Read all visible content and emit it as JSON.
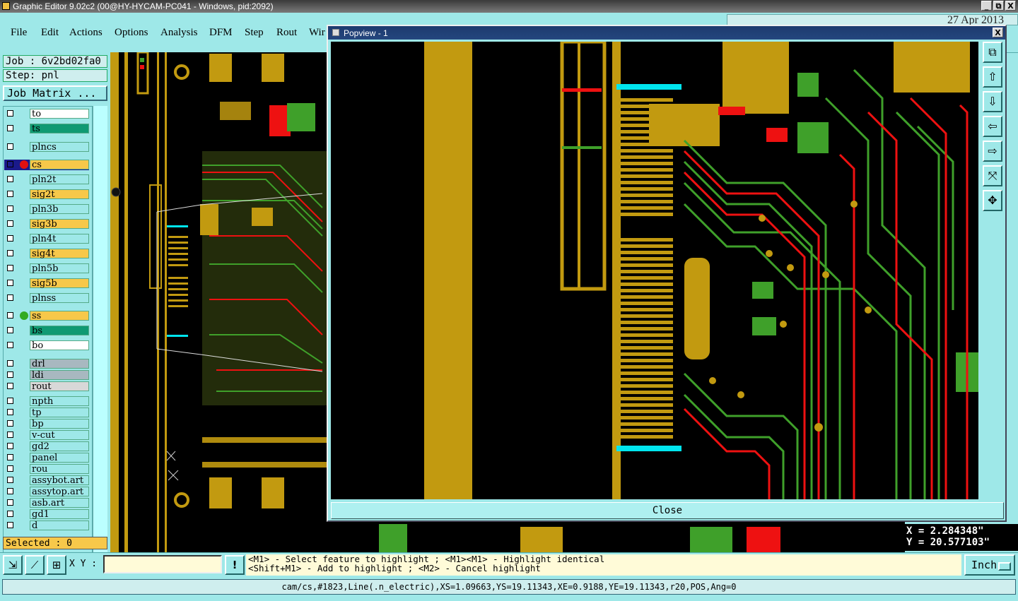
{
  "window": {
    "title": "Graphic Editor 9.02c2 (00@HY-HYCAM-PC041 - Windows, pid:2092)",
    "buttons": [
      "_",
      "⧉",
      "X"
    ]
  },
  "menu": {
    "items": [
      "File",
      "Edit",
      "Actions",
      "Options",
      "Analysis",
      "DFM",
      "Step",
      "Rout",
      "Wir"
    ],
    "date_text": "27 Apr 2013"
  },
  "left_panel": {
    "job": "Job : 6v2bd02fa0",
    "step": "Step: pnl",
    "job_matrix_label": "Job Matrix ...",
    "selected": "Selected : 0",
    "layers": [
      {
        "name": "to",
        "color": "#ffffff",
        "dot": ""
      },
      {
        "name": "ts",
        "color": "#0f9a73",
        "dot": ""
      },
      {
        "name": "plncs",
        "color": "#9ee8e8",
        "dot": ""
      },
      {
        "name": "cs",
        "color": "#f7c84a",
        "dot": "#e01010",
        "active": true
      },
      {
        "name": "pln2t",
        "color": "#9ee8e8",
        "dot": ""
      },
      {
        "name": "sig2t",
        "color": "#f7c84a",
        "dot": ""
      },
      {
        "name": "pln3b",
        "color": "#9ee8e8",
        "dot": ""
      },
      {
        "name": "sig3b",
        "color": "#f7c84a",
        "dot": ""
      },
      {
        "name": "pln4t",
        "color": "#9ee8e8",
        "dot": ""
      },
      {
        "name": "sig4t",
        "color": "#f7c84a",
        "dot": ""
      },
      {
        "name": "pln5b",
        "color": "#9ee8e8",
        "dot": ""
      },
      {
        "name": "sig5b",
        "color": "#f7c84a",
        "dot": ""
      },
      {
        "name": "plnss",
        "color": "#9ee8e8",
        "dot": ""
      },
      {
        "name": "ss",
        "color": "#f7c84a",
        "dot": "#33aa22"
      },
      {
        "name": "bs",
        "color": "#0f9a73",
        "dot": ""
      },
      {
        "name": "bo",
        "color": "#ffffff",
        "dot": ""
      },
      {
        "name": "drl",
        "color": "#a8b8c0",
        "dot": ""
      },
      {
        "name": "ldi",
        "color": "#a8b8c0",
        "dot": ""
      },
      {
        "name": "rout",
        "color": "#d8d8d8",
        "dot": ""
      },
      {
        "name": "npth",
        "color": "#9ee8e8",
        "dot": ""
      },
      {
        "name": "tp",
        "color": "#9ee8e8",
        "dot": ""
      },
      {
        "name": "bp",
        "color": "#9ee8e8",
        "dot": ""
      },
      {
        "name": "v-cut",
        "color": "#9ee8e8",
        "dot": ""
      },
      {
        "name": "gd2",
        "color": "#9ee8e8",
        "dot": ""
      },
      {
        "name": "panel",
        "color": "#9ee8e8",
        "dot": ""
      },
      {
        "name": "rou",
        "color": "#9ee8e8",
        "dot": ""
      },
      {
        "name": "assybot.art",
        "color": "#9ee8e8",
        "dot": ""
      },
      {
        "name": "assytop.art",
        "color": "#9ee8e8",
        "dot": ""
      },
      {
        "name": "asb.art",
        "color": "#9ee8e8",
        "dot": ""
      },
      {
        "name": "gd1",
        "color": "#9ee8e8",
        "dot": ""
      },
      {
        "name": "d",
        "color": "#9ee8e8",
        "dot": ""
      }
    ]
  },
  "popview": {
    "title": "Popview - 1",
    "close_label": "Close",
    "close_x": "X",
    "tools": [
      "zoom-fit-icon",
      "pan-up-icon",
      "pan-down-icon",
      "pan-left-icon",
      "pan-right-icon",
      "zoom-in-icon",
      "zoom-out-icon"
    ]
  },
  "coords": {
    "x": "X = 2.284348\"",
    "y": "Y = 20.577103\""
  },
  "bottom": {
    "xy_label": "X Y :",
    "xy_value": "",
    "info_btn": "!",
    "hint_line1": "<M1> - Select feature to highlight ; <M1><M1> - Highlight identical",
    "hint_line2": "<Shift+M1> - Add to highlight ; <M2> - Cancel highlight",
    "unit": "Inch",
    "status": "cam/cs,#1823,Line(.n_electric),XS=1.09663,YS=19.11343,XE=0.9188,YE=19.11343,r20,POS,Ang=0"
  },
  "colors": {
    "copper": "#c29a10",
    "trace_green": "#3fa02a",
    "trace_red": "#ee1111",
    "highlight": "#00e5ee",
    "background": "#9ee8e8"
  }
}
